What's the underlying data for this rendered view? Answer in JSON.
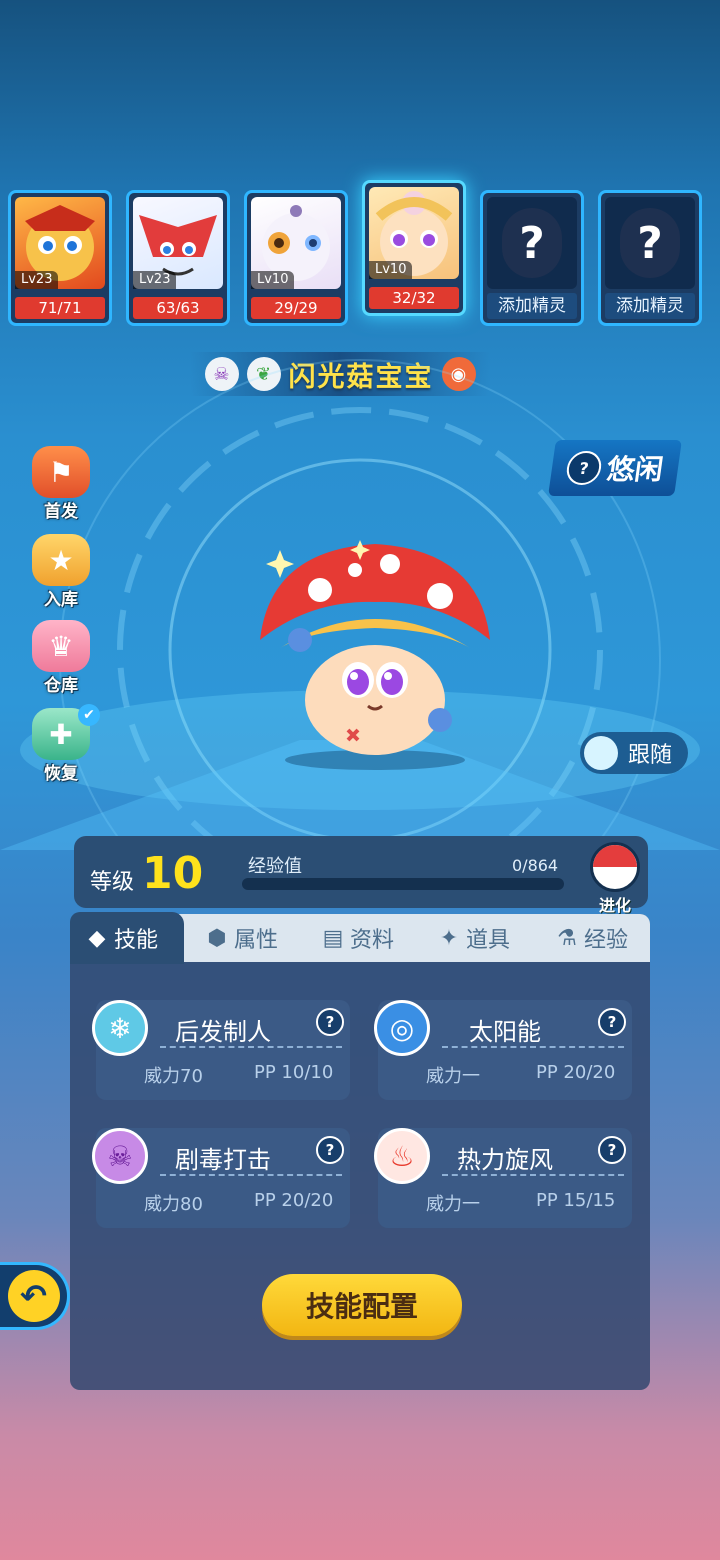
{
  "team": [
    {
      "lv": "Lv23",
      "hp": "71/71",
      "palette": "#f0a030"
    },
    {
      "lv": "Lv23",
      "hp": "63/63",
      "palette": "#e04a4a"
    },
    {
      "lv": "Lv10",
      "hp": "29/29",
      "palette": "#f0e6f6"
    },
    {
      "lv": "Lv10",
      "hp": "32/32",
      "palette": "#fdd7a8"
    },
    {
      "add": "添加精灵"
    },
    {
      "add": "添加精灵"
    }
  ],
  "pet": {
    "name": "闪光菇宝宝",
    "mood": "悠闲",
    "follow": "跟随"
  },
  "side": {
    "first": "首发",
    "store": "入库",
    "warehouse": "仓库",
    "restore": "恢复"
  },
  "level": {
    "label": "等级",
    "value": "10",
    "exp_label": "经验值",
    "exp_text": "0/864",
    "exp_fraction": 0,
    "evolve": "进化"
  },
  "tabs": [
    "技能",
    "属性",
    "资料",
    "道具",
    "经验"
  ],
  "skills": [
    {
      "name": "后发制人",
      "power": "威力70",
      "pp": "PP 10/10"
    },
    {
      "name": "太阳能",
      "power": "威力一",
      "pp": "PP 20/20"
    },
    {
      "name": "剧毒打击",
      "power": "威力80",
      "pp": "PP 20/20"
    },
    {
      "name": "热力旋风",
      "power": "威力一",
      "pp": "PP 15/15"
    }
  ],
  "config_button": "技能配置",
  "colors": {
    "accent": "#34c6ff",
    "level": "#ffe21c",
    "button": "#ffd93a"
  }
}
